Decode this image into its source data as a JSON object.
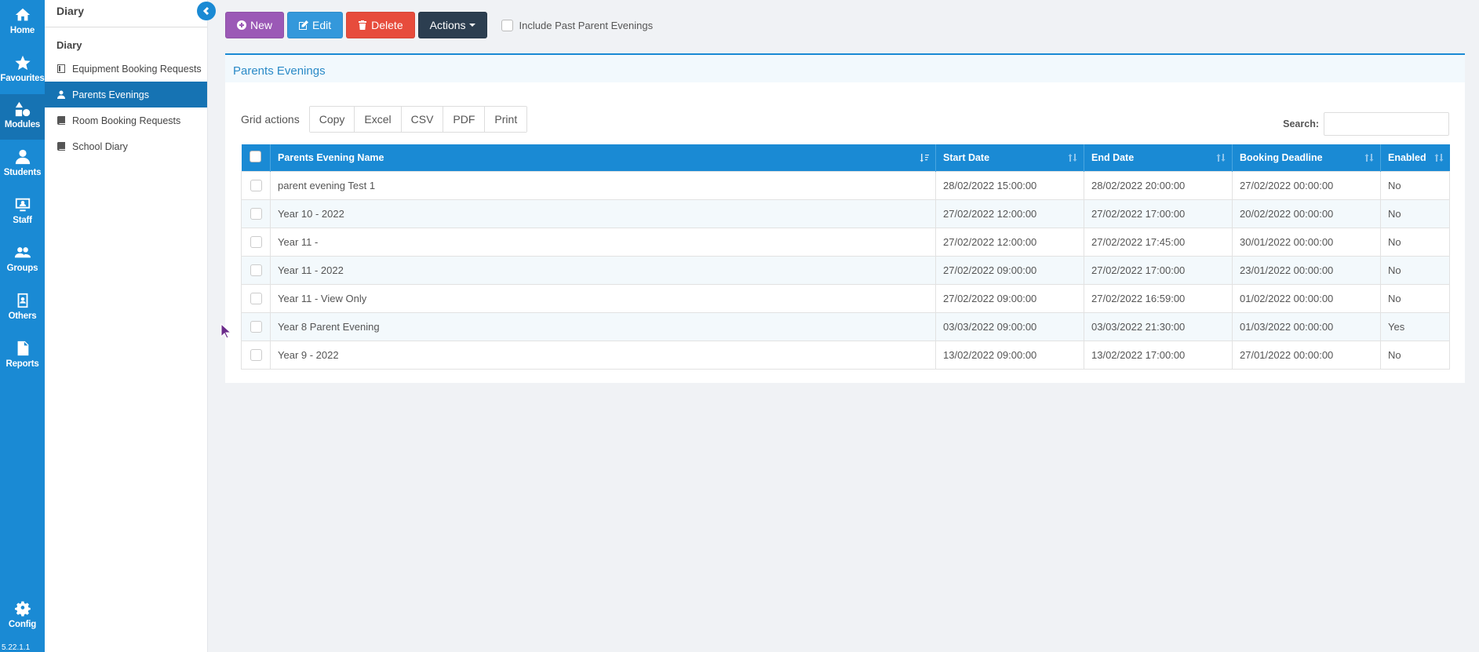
{
  "rail": {
    "items": [
      {
        "label": "Home",
        "icon": "home-icon"
      },
      {
        "label": "Favourites",
        "icon": "star-icon"
      },
      {
        "label": "Modules",
        "icon": "shapes-icon"
      },
      {
        "label": "Students",
        "icon": "user-icon"
      },
      {
        "label": "Staff",
        "icon": "staff-icon"
      },
      {
        "label": "Groups",
        "icon": "group-icon"
      },
      {
        "label": "Others",
        "icon": "contact-icon"
      },
      {
        "label": "Reports",
        "icon": "report-icon"
      }
    ],
    "config": {
      "label": "Config",
      "icon": "gear-icon"
    },
    "version": "5.22.1.1"
  },
  "subnav": {
    "header": "Diary",
    "section": "Diary",
    "items": [
      {
        "label": "Equipment Booking Requests"
      },
      {
        "label": "Parents Evenings"
      },
      {
        "label": "Room Booking Requests"
      },
      {
        "label": "School Diary"
      }
    ]
  },
  "toolbar": {
    "new_label": "New",
    "edit_label": "Edit",
    "delete_label": "Delete",
    "actions_label": "Actions",
    "include_past_label": "Include Past Parent Evenings"
  },
  "panel": {
    "title": "Parents Evenings",
    "grid_actions_label": "Grid actions",
    "grid_buttons": [
      "Copy",
      "Excel",
      "CSV",
      "PDF",
      "Print"
    ],
    "search_label": "Search:",
    "search_value": ""
  },
  "table": {
    "columns": [
      "Parents Evening Name",
      "Start Date",
      "End Date",
      "Booking Deadline",
      "Enabled"
    ],
    "rows": [
      [
        "parent evening Test 1",
        "28/02/2022 15:00:00",
        "28/02/2022 20:00:00",
        "27/02/2022 00:00:00",
        "No"
      ],
      [
        "Year 10 - 2022",
        "27/02/2022 12:00:00",
        "27/02/2022 17:00:00",
        "20/02/2022 00:00:00",
        "No"
      ],
      [
        "Year 11 -",
        "27/02/2022 12:00:00",
        "27/02/2022 17:45:00",
        "30/01/2022 00:00:00",
        "No"
      ],
      [
        "Year 11 - 2022",
        "27/02/2022 09:00:00",
        "27/02/2022 17:00:00",
        "23/01/2022 00:00:00",
        "No"
      ],
      [
        "Year 11 - View Only",
        "27/02/2022 09:00:00",
        "27/02/2022 16:59:00",
        "01/02/2022 00:00:00",
        "No"
      ],
      [
        "Year 8 Parent Evening",
        "03/03/2022 09:00:00",
        "03/03/2022 21:30:00",
        "01/03/2022 00:00:00",
        "Yes"
      ],
      [
        "Year 9 - 2022",
        "13/02/2022 09:00:00",
        "13/02/2022 17:00:00",
        "27/01/2022 00:00:00",
        "No"
      ]
    ]
  },
  "colors": {
    "primary": "#1a8ad4",
    "active": "#1673b3",
    "new": "#9b59b6",
    "edit": "#3498db",
    "delete": "#e74c3c",
    "actions": "#2c3e50"
  }
}
